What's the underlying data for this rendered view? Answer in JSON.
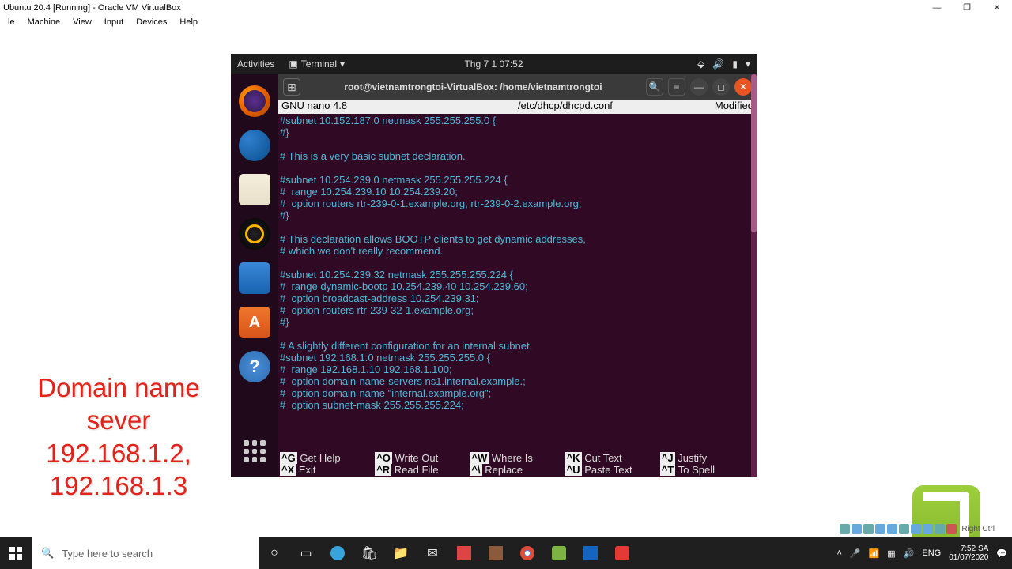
{
  "vbox": {
    "title": "Ubuntu 20.4 [Running] - Oracle VM VirtualBox",
    "menu": [
      "le",
      "Machine",
      "View",
      "Input",
      "Devices",
      "Help"
    ],
    "win_min": "—",
    "win_max": "❐",
    "win_close": "✕",
    "right_ctrl": "Right Ctrl"
  },
  "annotation": "Domain name sever 192.168.1.2, 192.168.1.3",
  "gnome": {
    "activities": "Activities",
    "app": "Terminal",
    "clock": "Thg 7 1  07:52",
    "net_icon": "▲",
    "snd_icon": "🔊",
    "pwr_icon": "🔋",
    "caret": "▾"
  },
  "dock": {
    "items": [
      {
        "name": "firefox-icon"
      },
      {
        "name": "thunderbird-icon"
      },
      {
        "name": "files-icon"
      },
      {
        "name": "rhythmbox-icon"
      },
      {
        "name": "libreoffice-writer-icon"
      },
      {
        "name": "ubuntu-software-icon"
      },
      {
        "name": "help-icon"
      }
    ]
  },
  "term": {
    "newtab": "⊞",
    "title": "root@vietnamtrongtoi-VirtualBox: /home/vietnamtrongtoi",
    "search": "🔍",
    "menu": "≡",
    "min": "—",
    "max": "◻",
    "close": "✕"
  },
  "nano": {
    "ver": "  GNU nano 4.8",
    "file": "/etc/dhcp/dhcpd.conf",
    "status": "Modified "
  },
  "editor": {
    "lines": [
      "#subnet 10.152.187.0 netmask 255.255.255.0 {",
      "#}",
      "",
      "# This is a very basic subnet declaration.",
      "",
      "#subnet 10.254.239.0 netmask 255.255.255.224 {",
      "#  range 10.254.239.10 10.254.239.20;",
      "#  option routers rtr-239-0-1.example.org, rtr-239-0-2.example.org;",
      "#}",
      "",
      "# This declaration allows BOOTP clients to get dynamic addresses,",
      "# which we don't really recommend.",
      "",
      "#subnet 10.254.239.32 netmask 255.255.255.224 {",
      "#  range dynamic-bootp 10.254.239.40 10.254.239.60;",
      "#  option broadcast-address 10.254.239.31;",
      "#  option routers rtr-239-32-1.example.org;",
      "#}",
      "",
      "# A slightly different configuration for an internal subnet.",
      "#subnet 192.168.1.0 netmask 255.255.255.0 {",
      "#  range 192.168.1.10 192.168.1.100;",
      "#  option domain-name-servers ns1.internal.example.;",
      "#  option domain-name \"internal.example.org\";",
      "#  option subnet-mask 255.255.255.224;"
    ]
  },
  "nanoft": {
    "r1": [
      [
        "^G",
        "Get Help"
      ],
      [
        "^O",
        "Write Out"
      ],
      [
        "^W",
        "Where Is"
      ],
      [
        "^K",
        "Cut Text"
      ],
      [
        "^J",
        "Justify"
      ]
    ],
    "r2": [
      [
        "^X",
        "Exit"
      ],
      [
        "^R",
        "Read File"
      ],
      [
        "^\\",
        "Replace"
      ],
      [
        "^U",
        "Paste Text"
      ],
      [
        "^T",
        "To Spell"
      ]
    ]
  },
  "win": {
    "search_ph": "Type here to search",
    "lang": "ENG",
    "time": "7:52 SA",
    "date": "01/07/2020"
  }
}
